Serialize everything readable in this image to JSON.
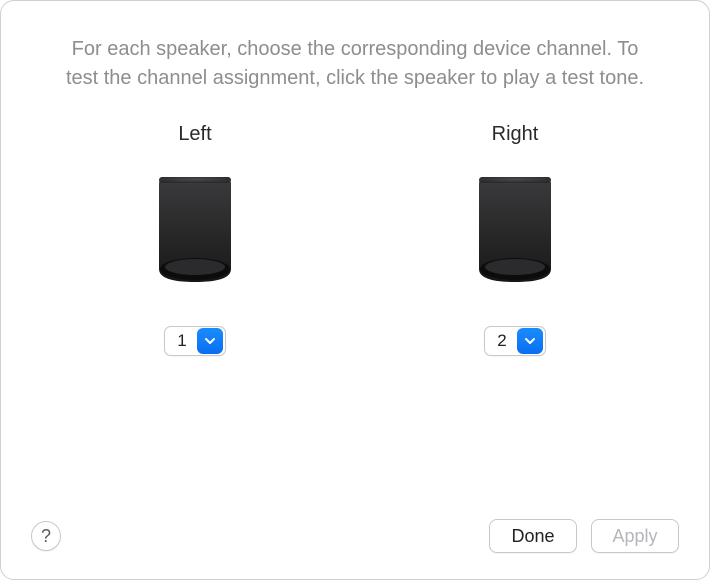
{
  "instructions": "For each speaker, choose the corresponding device channel. To test the channel assignment, click the speaker to play a test tone.",
  "speakers": {
    "left": {
      "label": "Left",
      "channel_value": "1"
    },
    "right": {
      "label": "Right",
      "channel_value": "2"
    }
  },
  "footer": {
    "help_symbol": "?",
    "done_label": "Done",
    "apply_label": "Apply",
    "apply_enabled": false
  }
}
